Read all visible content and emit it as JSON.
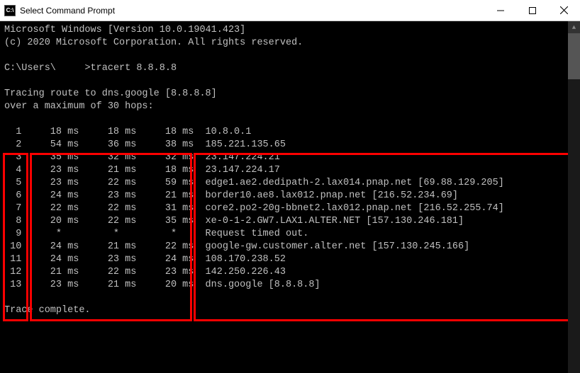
{
  "title_bar": {
    "icon_label": "C:\\",
    "title": "Select Command Prompt"
  },
  "header": {
    "line1": "Microsoft Windows [Version 10.0.19041.423]",
    "line2": "(c) 2020 Microsoft Corporation. All rights reserved."
  },
  "prompt": {
    "path": "C:\\Users\\",
    "user_redacted": "     ",
    "command": ">tracert 8.8.8.8"
  },
  "trace_header": {
    "line1": "Tracing route to dns.google [8.8.8.8]",
    "line2": "over a maximum of 30 hops:"
  },
  "hops": [
    {
      "n": "1",
      "t1": "18 ms",
      "t2": "18 ms",
      "t3": "18 ms",
      "host": "10.8.0.1"
    },
    {
      "n": "2",
      "t1": "54 ms",
      "t2": "36 ms",
      "t3": "38 ms",
      "host": "185.221.135.65"
    },
    {
      "n": "3",
      "t1": "35 ms",
      "t2": "32 ms",
      "t3": "32 ms",
      "host": "23.147.224.21"
    },
    {
      "n": "4",
      "t1": "23 ms",
      "t2": "21 ms",
      "t3": "18 ms",
      "host": "23.147.224.17"
    },
    {
      "n": "5",
      "t1": "23 ms",
      "t2": "22 ms",
      "t3": "59 ms",
      "host": "edge1.ae2.dedipath-2.lax014.pnap.net [69.88.129.205]"
    },
    {
      "n": "6",
      "t1": "24 ms",
      "t2": "23 ms",
      "t3": "21 ms",
      "host": "border10.ae8.lax012.pnap.net [216.52.234.69]"
    },
    {
      "n": "7",
      "t1": "22 ms",
      "t2": "22 ms",
      "t3": "31 ms",
      "host": "core2.po2-20g-bbnet2.lax012.pnap.net [216.52.255.74]"
    },
    {
      "n": "8",
      "t1": "20 ms",
      "t2": "22 ms",
      "t3": "35 ms",
      "host": "xe-0-1-2.GW7.LAX1.ALTER.NET [157.130.246.181]"
    },
    {
      "n": "9",
      "t1": "*",
      "t2": "*",
      "t3": "*",
      "host": "Request timed out."
    },
    {
      "n": "10",
      "t1": "24 ms",
      "t2": "21 ms",
      "t3": "22 ms",
      "host": "google-gw.customer.alter.net [157.130.245.166]"
    },
    {
      "n": "11",
      "t1": "24 ms",
      "t2": "23 ms",
      "t3": "24 ms",
      "host": "108.170.238.52"
    },
    {
      "n": "12",
      "t1": "21 ms",
      "t2": "22 ms",
      "t3": "23 ms",
      "host": "142.250.226.43"
    },
    {
      "n": "13",
      "t1": "23 ms",
      "t2": "21 ms",
      "t3": "20 ms",
      "host": "dns.google [8.8.8.8]"
    }
  ],
  "footer": {
    "complete": "Trace complete."
  }
}
